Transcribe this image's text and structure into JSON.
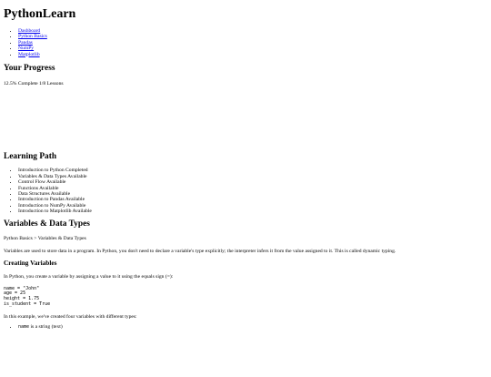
{
  "app": {
    "title": "PythonLearn"
  },
  "nav": {
    "items": [
      {
        "label": "Dashboard"
      },
      {
        "label": "Python Basics"
      },
      {
        "label": "Pandas"
      },
      {
        "label": "NumPy"
      },
      {
        "label": "Matplotlib"
      }
    ]
  },
  "progress": {
    "heading": "Your Progress",
    "text": "12.5% Complete 1/8 Lessons"
  },
  "learning_path": {
    "heading": "Learning Path",
    "items": [
      {
        "label": "Introduction to Python Completed"
      },
      {
        "label": "Variables & Data Types Available"
      },
      {
        "label": "Control Flow Available"
      },
      {
        "label": "Functions Available"
      },
      {
        "label": "Data Structures Available"
      },
      {
        "label": "Introduction to Pandas Available"
      },
      {
        "label": "Introduction to NumPy Available"
      },
      {
        "label": "Introduction to Matplotlib Available"
      }
    ]
  },
  "lesson": {
    "title": "Variables & Data Types",
    "breadcrumb": "Python Basics > Variables & Data Types",
    "intro": "Variables are used to store data in a program. In Python, you don't need to declare a variable's type explicitly; the interpreter infers it from the value assigned to it. This is called dynamic typing.",
    "section_heading": "Creating Variables",
    "section_text": "In Python, you create a variable by assigning a value to it using the equals sign (=):",
    "code": "name = \"John\"\nage = 25\nheight = 1.75\nis_student = True",
    "example_text": "In this example, we've created four variables with different types:",
    "type_items": [
      {
        "code": "name",
        "text": " is a string (text)"
      }
    ]
  }
}
